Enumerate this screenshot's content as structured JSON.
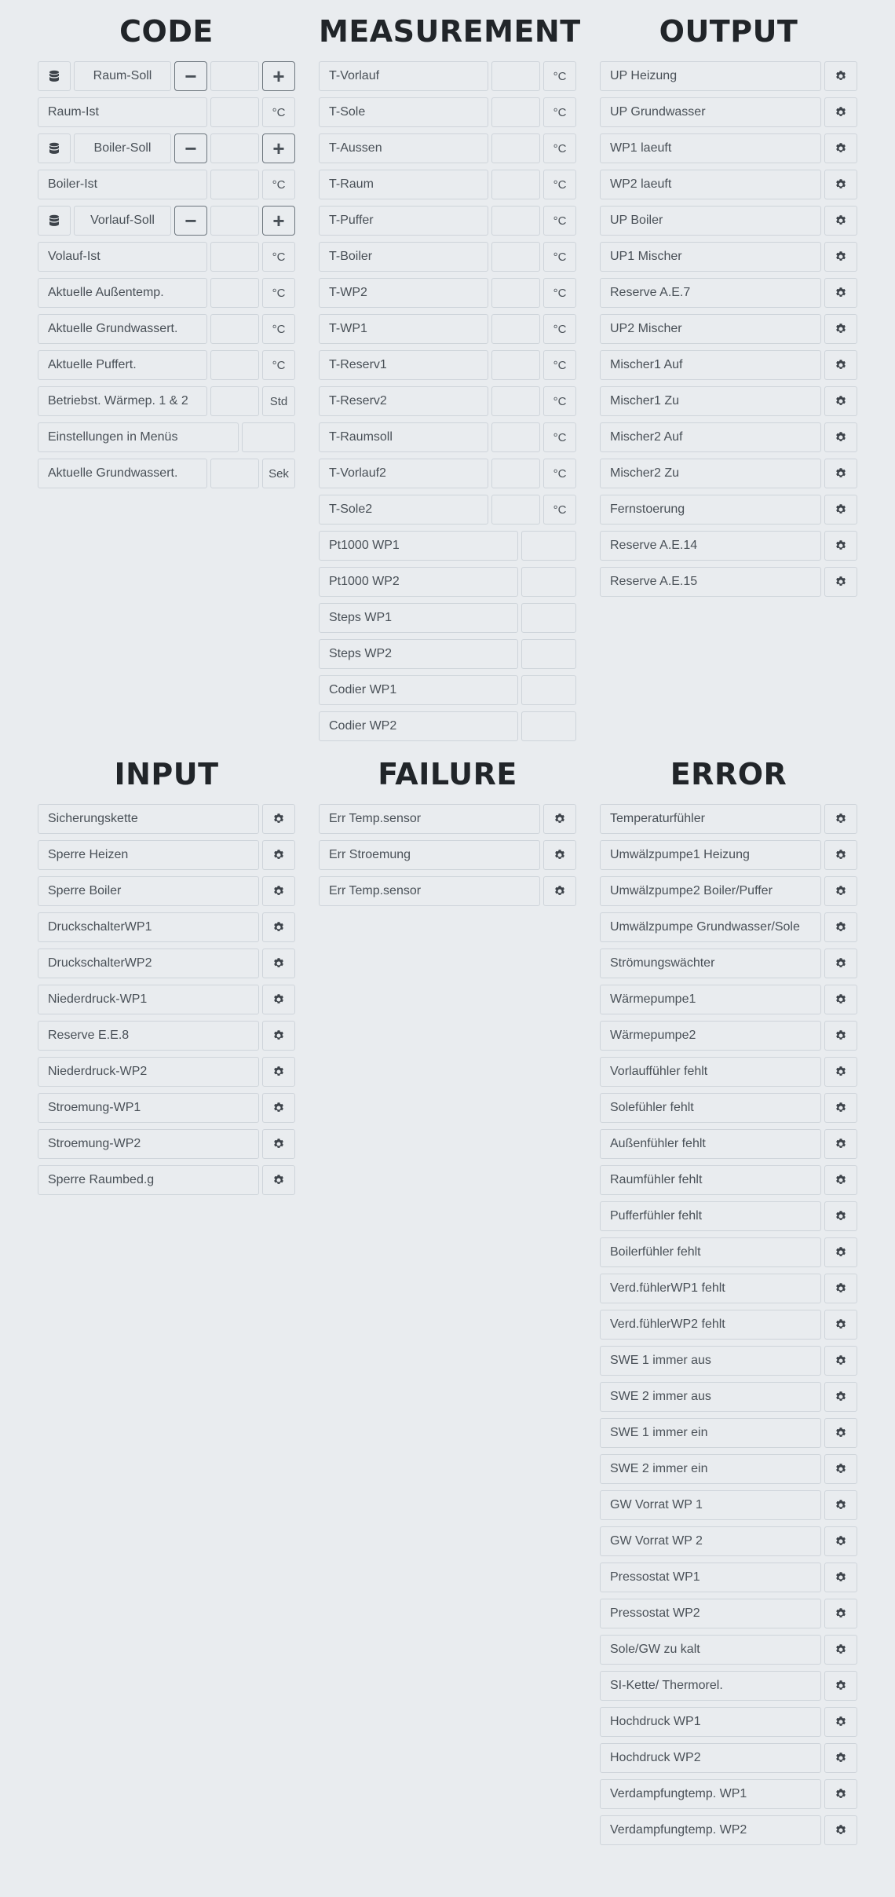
{
  "headings": {
    "code": "CODE",
    "measurement": "MEASUREMENT",
    "output": "OUTPUT",
    "input": "INPUT",
    "failure": "FAILURE",
    "error": "ERROR"
  },
  "code": {
    "setpoints": [
      {
        "label": "Raum-Soll",
        "value": "",
        "minus": "−",
        "plus": "+"
      },
      {
        "label": "Boiler-Soll",
        "value": "",
        "minus": "−",
        "plus": "+"
      },
      {
        "label": "Vorlauf-Soll",
        "value": "",
        "minus": "−",
        "plus": "+"
      }
    ],
    "rows": [
      {
        "label": "Raum-Ist",
        "value": "",
        "unit": "°C"
      },
      {
        "label": "Boiler-Ist",
        "value": "",
        "unit": "°C"
      },
      {
        "label": "Volauf-Ist",
        "value": "",
        "unit": "°C"
      },
      {
        "label": "Aktuelle Außentemp.",
        "value": "",
        "unit": "°C"
      },
      {
        "label": "Aktuelle Grundwassert.",
        "value": "",
        "unit": "°C"
      },
      {
        "label": "Aktuelle Puffert.",
        "value": "",
        "unit": "°C"
      },
      {
        "label": "Betriebst. Wärmep. 1 & 2",
        "value": "",
        "unit": "Std"
      },
      {
        "label": "Einstellungen in Menüs",
        "value": ""
      },
      {
        "label": "Aktuelle Grundwassert.",
        "value": "",
        "unit": "Sek"
      }
    ]
  },
  "measurement": {
    "temps": [
      {
        "label": "T-Vorlauf",
        "value": "",
        "unit": "°C"
      },
      {
        "label": "T-Sole",
        "value": "",
        "unit": "°C"
      },
      {
        "label": "T-Aussen",
        "value": "",
        "unit": "°C"
      },
      {
        "label": "T-Raum",
        "value": "",
        "unit": "°C"
      },
      {
        "label": "T-Puffer",
        "value": "",
        "unit": "°C"
      },
      {
        "label": "T-Boiler",
        "value": "",
        "unit": "°C"
      },
      {
        "label": "T-WP2",
        "value": "",
        "unit": "°C"
      },
      {
        "label": "T-WP1",
        "value": "",
        "unit": "°C"
      },
      {
        "label": "T-Reserv1",
        "value": "",
        "unit": "°C"
      },
      {
        "label": "T-Reserv2",
        "value": "",
        "unit": "°C"
      },
      {
        "label": "T-Raumsoll",
        "value": "",
        "unit": "°C"
      },
      {
        "label": "T-Vorlauf2",
        "value": "",
        "unit": "°C"
      },
      {
        "label": "T-Sole2",
        "value": "",
        "unit": "°C"
      }
    ],
    "misc": [
      {
        "label": "Pt1000 WP1",
        "value": ""
      },
      {
        "label": "Pt1000 WP2",
        "value": ""
      },
      {
        "label": "Steps WP1",
        "value": ""
      },
      {
        "label": "Steps WP2",
        "value": ""
      },
      {
        "label": "Codier WP1",
        "value": ""
      },
      {
        "label": "Codier WP2",
        "value": ""
      }
    ]
  },
  "output": {
    "items": [
      "UP Heizung",
      "UP Grundwasser",
      "WP1 laeuft",
      "WP2 laeuft",
      "UP Boiler",
      "UP1 Mischer",
      "Reserve A.E.7",
      "UP2 Mischer",
      "Mischer1 Auf",
      "Mischer1 Zu",
      "Mischer2 Auf",
      "Mischer2 Zu",
      "Fernstoerung",
      "Reserve A.E.14",
      "Reserve A.E.15"
    ]
  },
  "input": {
    "items": [
      "Sicherungskette",
      "Sperre Heizen",
      "Sperre Boiler",
      "DruckschalterWP1",
      "DruckschalterWP2",
      "Niederdruck-WP1",
      "Reserve E.E.8",
      "Niederdruck-WP2",
      "Stroemung-WP1",
      "Stroemung-WP2",
      "Sperre Raumbed.g"
    ]
  },
  "failure": {
    "items": [
      "Err Temp.sensor",
      "Err Stroemung",
      "Err Temp.sensor"
    ]
  },
  "error": {
    "items": [
      "Temperaturfühler",
      "Umwälzpumpe1 Heizung",
      "Umwälzpumpe2 Boiler/Puffer",
      "Umwälzpumpe Grundwasser/Sole",
      "Strömungswächter",
      "Wärmepumpe1",
      "Wärmepumpe2",
      "Vorlauffühler fehlt",
      "Solefühler fehlt",
      "Außenfühler fehlt",
      "Raumfühler fehlt",
      "Pufferfühler fehlt",
      "Boilerfühler fehlt",
      "Verd.fühlerWP1 fehlt",
      "Verd.fühlerWP2 fehlt",
      "SWE 1 immer aus",
      "SWE 2 immer aus",
      "SWE 1 immer ein",
      "SWE 2 immer ein",
      "GW Vorrat WP 1",
      "GW Vorrat WP 2",
      "Pressostat WP1",
      "Pressostat WP2",
      "Sole/GW zu kalt",
      "SI-Kette/ Thermorel.",
      "Hochdruck WP1",
      "Hochdruck WP2",
      "Verdampfungtemp. WP1",
      "Verdampfungtemp. WP2"
    ]
  },
  "icons": {
    "gear": "gear-icon",
    "database": "database-icon"
  }
}
